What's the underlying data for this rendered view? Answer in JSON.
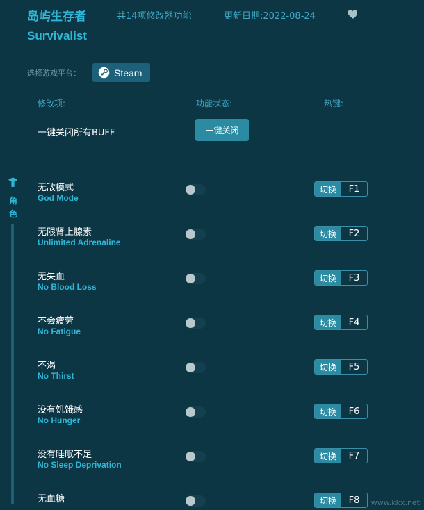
{
  "header": {
    "title_cn": "岛屿生存者",
    "feature_count": "共14项修改器功能",
    "update_date": "更新日期:2022-08-24",
    "title_en": "Survivalist",
    "favorite_icon": "heart-icon"
  },
  "platform": {
    "label": "选择游戏平台：",
    "button_label": "Steam",
    "icon": "steam-icon"
  },
  "columns": {
    "mod": "修改项:",
    "state": "功能状态:",
    "hotkey": "热键:"
  },
  "all_buff": {
    "label": "一键关闭所有BUFF",
    "button_label": "一键关闭"
  },
  "category": {
    "icon": "character-icon",
    "label": "角色"
  },
  "items": [
    {
      "cn": "无敌模式",
      "en": "God Mode",
      "hotkey_label": "切换",
      "key": "F1"
    },
    {
      "cn": "无限肾上腺素",
      "en": "Unlimited Adrenaline",
      "hotkey_label": "切换",
      "key": "F2"
    },
    {
      "cn": "无失血",
      "en": "No Blood Loss",
      "hotkey_label": "切换",
      "key": "F3"
    },
    {
      "cn": "不会疲劳",
      "en": "No Fatigue",
      "hotkey_label": "切换",
      "key": "F4"
    },
    {
      "cn": "不渴",
      "en": "No Thirst",
      "hotkey_label": "切换",
      "key": "F5"
    },
    {
      "cn": "没有饥饿感",
      "en": "No Hunger",
      "hotkey_label": "切换",
      "key": "F6"
    },
    {
      "cn": "没有睡眠不足",
      "en": "No Sleep Deprivation",
      "hotkey_label": "切换",
      "key": "F7"
    },
    {
      "cn": "无血糖",
      "en": "",
      "hotkey_label": "切换",
      "key": "F8"
    }
  ],
  "watermark": "www.kkx.net",
  "colors": {
    "background": "#0d3645",
    "accent": "#2fb6d6",
    "button": "#2a8ba3"
  }
}
